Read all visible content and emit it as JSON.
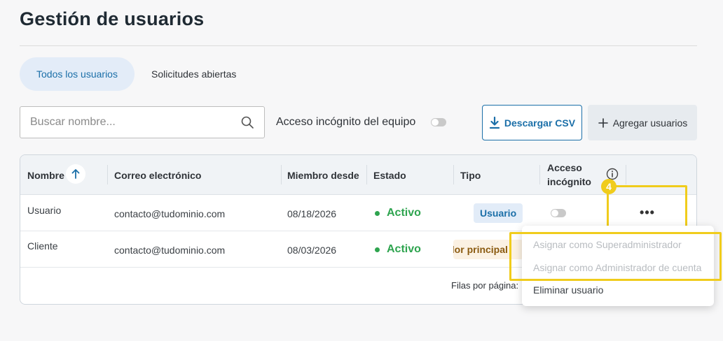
{
  "page": {
    "title": "Gestión de usuarios"
  },
  "tabs": [
    {
      "label": "Todos los usuarios",
      "active": true
    },
    {
      "label": "Solicitudes abiertas",
      "active": false
    }
  ],
  "search": {
    "placeholder": "Buscar nombre..."
  },
  "team_incognito": {
    "label": "Acceso incógnito del equipo",
    "enabled": false
  },
  "buttons": {
    "download_csv": "Descargar CSV",
    "add_users": "Agregar usuarios"
  },
  "table": {
    "headers": {
      "name": "Nombre",
      "email": "Correo electrónico",
      "member_since": "Miembro desde",
      "status": "Estado",
      "type": "Tipo",
      "incognito_line1": "Acceso",
      "incognito_line2": "incógnito"
    },
    "rows": [
      {
        "name": "Usuario",
        "email": "contacto@tudominio.com",
        "member_since": "08/18/2026",
        "status": "Activo",
        "type": "Usuario",
        "incognito": false
      },
      {
        "name": "Cliente",
        "email": "contacto@tudominio.com",
        "member_since": "08/03/2026",
        "status": "Activo",
        "type": "Administrador principal",
        "incognito": false
      }
    ],
    "pagination_label": "Filas por página:"
  },
  "row_menu": {
    "items": [
      {
        "label": "Asignar como Superadministrador",
        "disabled": true
      },
      {
        "label": "Asignar como Administrador de cuenta",
        "disabled": true
      },
      {
        "label": "Eliminar usuario",
        "disabled": false
      }
    ]
  },
  "annotation": {
    "step": "4"
  },
  "colors": {
    "accent": "#1b6fa8",
    "active_status": "#2ea44f",
    "highlight": "#f0cc1c"
  },
  "icons": [
    "search-icon",
    "download-icon",
    "plus-icon",
    "sort-ascending-icon",
    "info-icon",
    "more-horizontal-icon"
  ]
}
